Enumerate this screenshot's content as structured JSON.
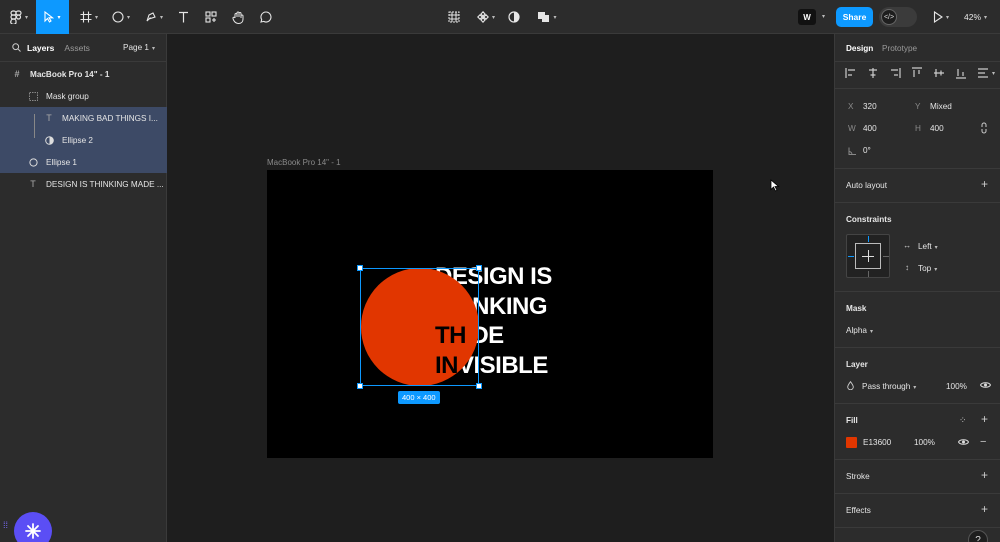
{
  "toolbar": {
    "share_label": "Share",
    "zoom": "42%",
    "avatar_initials": "W"
  },
  "left_panel": {
    "tabs": [
      "Layers",
      "Assets"
    ],
    "page": "Page 1",
    "layers": [
      {
        "name": "MacBook Pro 14\" - 1",
        "icon": "frame-icon"
      },
      {
        "name": "Mask group",
        "icon": "mask-group-icon"
      },
      {
        "name": "MAKING BAD THINGS I...",
        "icon": "text-icon"
      },
      {
        "name": "Ellipse 2",
        "icon": "mask-icon"
      },
      {
        "name": "Ellipse 1",
        "icon": "ellipse-icon"
      },
      {
        "name": "DESIGN IS THINKING MADE ...",
        "icon": "text-icon"
      }
    ]
  },
  "canvas": {
    "frame_label": "MacBook Pro 14\" - 1",
    "text_lines": [
      "DESIGN IS",
      "THINKING",
      "MADE",
      "INVISIBLE"
    ],
    "circle_text_lines": [
      "",
      "TH",
      "TH",
      "IN"
    ],
    "size_badge": "400 × 400",
    "circle_color": "#E13600"
  },
  "right_panel": {
    "tabs": [
      "Design",
      "Prototype"
    ],
    "x_label": "X",
    "x_value": "320",
    "y_label": "Y",
    "y_value": "Mixed",
    "w_label": "W",
    "w_value": "400",
    "h_label": "H",
    "h_value": "400",
    "rotation": "0°",
    "auto_layout": "Auto layout",
    "constraints": "Constraints",
    "constraint_h": "Left",
    "constraint_v": "Top",
    "mask": "Mask",
    "mask_type": "Alpha",
    "layer": "Layer",
    "blend": "Pass through",
    "layer_opacity": "100%",
    "fill": "Fill",
    "fill_hex": "E13600",
    "fill_opacity": "100%",
    "stroke": "Stroke",
    "effects": "Effects"
  }
}
